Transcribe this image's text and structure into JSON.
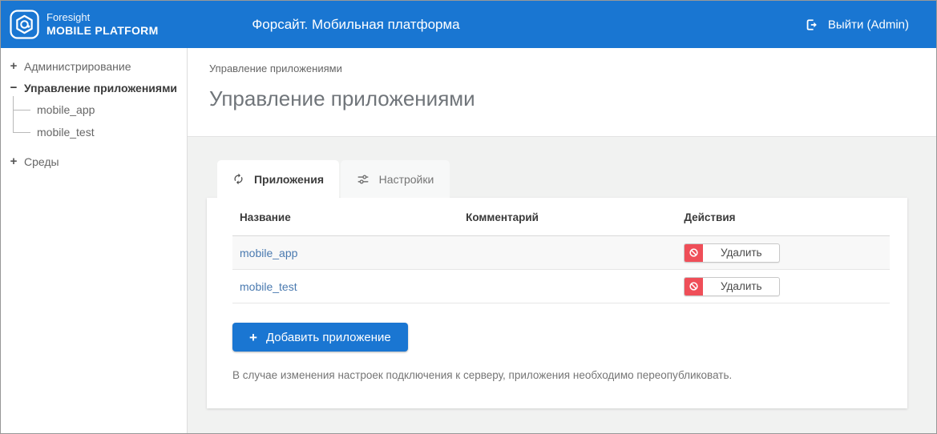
{
  "header": {
    "logo_line1": "Foresight",
    "logo_line2": "MOBILE PLATFORM",
    "title": "Форсайт. Мобильная платформа",
    "logout_label": "Выйти (Admin)"
  },
  "sidebar": {
    "items": [
      {
        "toggle": "+",
        "label": "Администрирование",
        "expanded": false,
        "children": []
      },
      {
        "toggle": "−",
        "label": "Управление приложениями",
        "expanded": true,
        "children": [
          "mobile_app",
          "mobile_test"
        ]
      },
      {
        "toggle": "+",
        "label": "Среды",
        "expanded": false,
        "children": []
      }
    ]
  },
  "main": {
    "breadcrumb": "Управление приложениями",
    "page_title": "Управление приложениями",
    "tabs": [
      {
        "label": "Приложения",
        "icon": "refresh-icon",
        "active": true
      },
      {
        "label": "Настройки",
        "icon": "sliders-icon",
        "active": false
      }
    ],
    "table": {
      "columns": [
        "Название",
        "Комментарий",
        "Действия"
      ],
      "rows": [
        {
          "name": "mobile_app",
          "comment": "",
          "action": "Удалить"
        },
        {
          "name": "mobile_test",
          "comment": "",
          "action": "Удалить"
        }
      ]
    },
    "add_button": {
      "icon": "+",
      "label": "Добавить приложение"
    },
    "note": "В случае изменения настроек подключения к серверу, приложения необходимо переопубликовать."
  },
  "colors": {
    "header_bg": "#1976d2",
    "accent_blue": "#1a76d2",
    "delete_red": "#ef4e58",
    "link_blue": "#4a7ab0",
    "page_bg": "#f1f2f1"
  }
}
